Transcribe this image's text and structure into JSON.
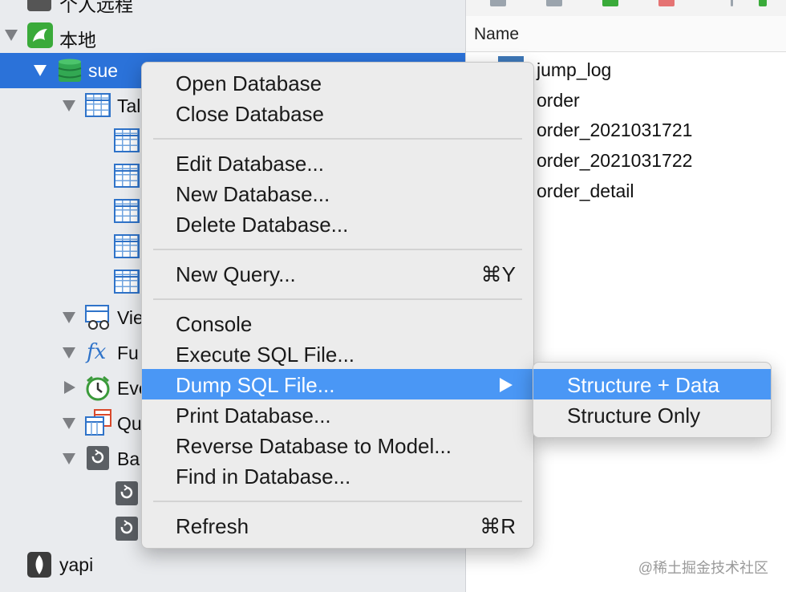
{
  "sidebar": {
    "top_connection": "个人远程",
    "local_connection": "本地",
    "database": "sue",
    "groups": {
      "tables": "Tal",
      "views": "Vie",
      "functions": "Fu",
      "events": "Eve",
      "queries": "Qu",
      "backups": "Ba"
    },
    "bottom_connection": "yapi"
  },
  "right_panel": {
    "column_header": "Name",
    "tables": [
      "jump_log",
      "order",
      "order_2021031721",
      "order_2021031722",
      "order_detail"
    ]
  },
  "context_menu": {
    "open_database": "Open Database",
    "close_database": "Close Database",
    "edit_database": "Edit Database...",
    "new_database": "New Database...",
    "delete_database": "Delete Database...",
    "new_query": "New Query...",
    "new_query_shortcut": "⌘Y",
    "console": "Console",
    "execute_sql_file": "Execute SQL File...",
    "dump_sql_file": "Dump SQL File...",
    "print_database": "Print Database...",
    "reverse_database": "Reverse Database to Model...",
    "find_in_database": "Find in Database...",
    "refresh": "Refresh",
    "refresh_shortcut": "⌘R"
  },
  "submenu": {
    "structure_data": "Structure + Data",
    "structure_only": "Structure Only"
  },
  "watermark": "@稀土掘金技术社区",
  "colors": {
    "selection": "#2b72d9",
    "menu_highlight": "#4a97f5",
    "menu_bg": "#ececec",
    "sidebar_bg": "#e9ebee"
  }
}
